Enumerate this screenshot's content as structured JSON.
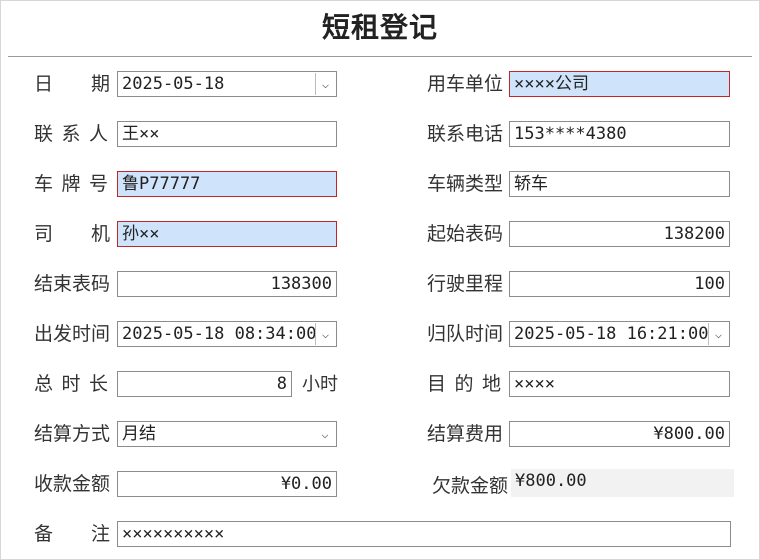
{
  "form": {
    "title": "短租登记",
    "left": {
      "date": {
        "label": "日　　期",
        "value": "2025-05-18"
      },
      "contact": {
        "label": "联 系 人",
        "value": "王××"
      },
      "plate": {
        "label": "车 牌 号",
        "value": "鲁P77777"
      },
      "driver": {
        "label": "司　　机",
        "value": "孙××"
      },
      "end_meter": {
        "label": "结束表码",
        "value": "138300"
      },
      "depart_time": {
        "label": "出发时间",
        "value": "2025-05-18 08:34:00"
      },
      "total_time": {
        "label": "总 时 长",
        "value": "8",
        "unit": "小时"
      },
      "settle_method": {
        "label": "结算方式",
        "value": "月结"
      },
      "received": {
        "label": "收款金额",
        "value": "¥0.00"
      }
    },
    "right": {
      "unit": {
        "label": "用车单位",
        "value": "××××公司"
      },
      "phone": {
        "label": "联系电话",
        "value": "153****4380"
      },
      "vehicle_type": {
        "label": "车辆类型",
        "value": "轿车"
      },
      "start_meter": {
        "label": "起始表码",
        "value": "138200"
      },
      "mileage": {
        "label": "行驶里程",
        "value": "100"
      },
      "return_time": {
        "label": "归队时间",
        "value": "2025-05-18 16:21:00"
      },
      "destination": {
        "label": "目 的 地",
        "value": "××××"
      },
      "settle_fee": {
        "label": "结算费用",
        "value": "¥800.00"
      },
      "owed": {
        "label": "欠款金额",
        "value": "¥800.00"
      }
    },
    "remark": {
      "label": "备　　注",
      "value": "××××××××××"
    }
  },
  "colors": {
    "highlight_fill": "#cfe3fb",
    "highlight_border": "#c0272d",
    "field_border": "#8c8c8c"
  },
  "icons": {
    "dropdown": "chevron-down-icon"
  }
}
